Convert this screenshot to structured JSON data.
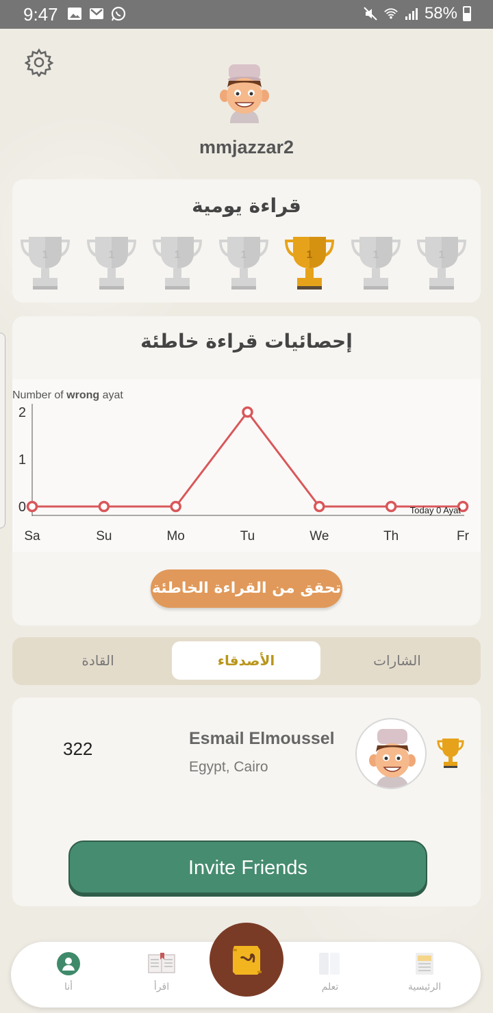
{
  "status_bar": {
    "time": "9:47",
    "battery": "58%"
  },
  "profile": {
    "username": "mmjazzar2"
  },
  "daily_reading": {
    "title": "قراءة يومية",
    "trophies": [
      {
        "label": "1",
        "active": false
      },
      {
        "label": "1",
        "active": false
      },
      {
        "label": "1",
        "active": false
      },
      {
        "label": "1",
        "active": false
      },
      {
        "label": "1",
        "active": true
      },
      {
        "label": "1",
        "active": false
      },
      {
        "label": "1",
        "active": false
      }
    ]
  },
  "wrong_stats": {
    "title": "إحصائيات قراءة خاطئة",
    "check_button": "تحقق من القراءة الخاطئة"
  },
  "chart_data": {
    "type": "line",
    "ylabel_prefix": "Number of ",
    "ylabel_bold": "wrong",
    "ylabel_suffix": " ayat",
    "categories": [
      "Sa",
      "Su",
      "Mo",
      "Tu",
      "We",
      "Th",
      "Fr"
    ],
    "values": [
      0,
      0,
      0,
      2,
      0,
      0,
      0
    ],
    "yticks": [
      "0",
      "1",
      "2"
    ],
    "ylim": [
      0,
      2
    ],
    "annotation": "Today 0 Ayat",
    "color": "#d9575a"
  },
  "tabs": [
    {
      "label": "القادة",
      "active": false
    },
    {
      "label": "الأصدقاء",
      "active": true
    },
    {
      "label": "الشارات",
      "active": false
    }
  ],
  "friend": {
    "score": "322",
    "name": "Esmail Elmoussel",
    "location": "Egypt, Cairo"
  },
  "invite_button": "Invite Friends",
  "bottom_nav": {
    "me": "أنا",
    "read": "اقرأ",
    "learn": "تعلم",
    "home": "الرئيسية"
  },
  "colors": {
    "accent_orange": "#e0995a",
    "invite_green": "#468c70",
    "trophy_gold": "#e6a21a",
    "center_button": "#7a3b26"
  }
}
